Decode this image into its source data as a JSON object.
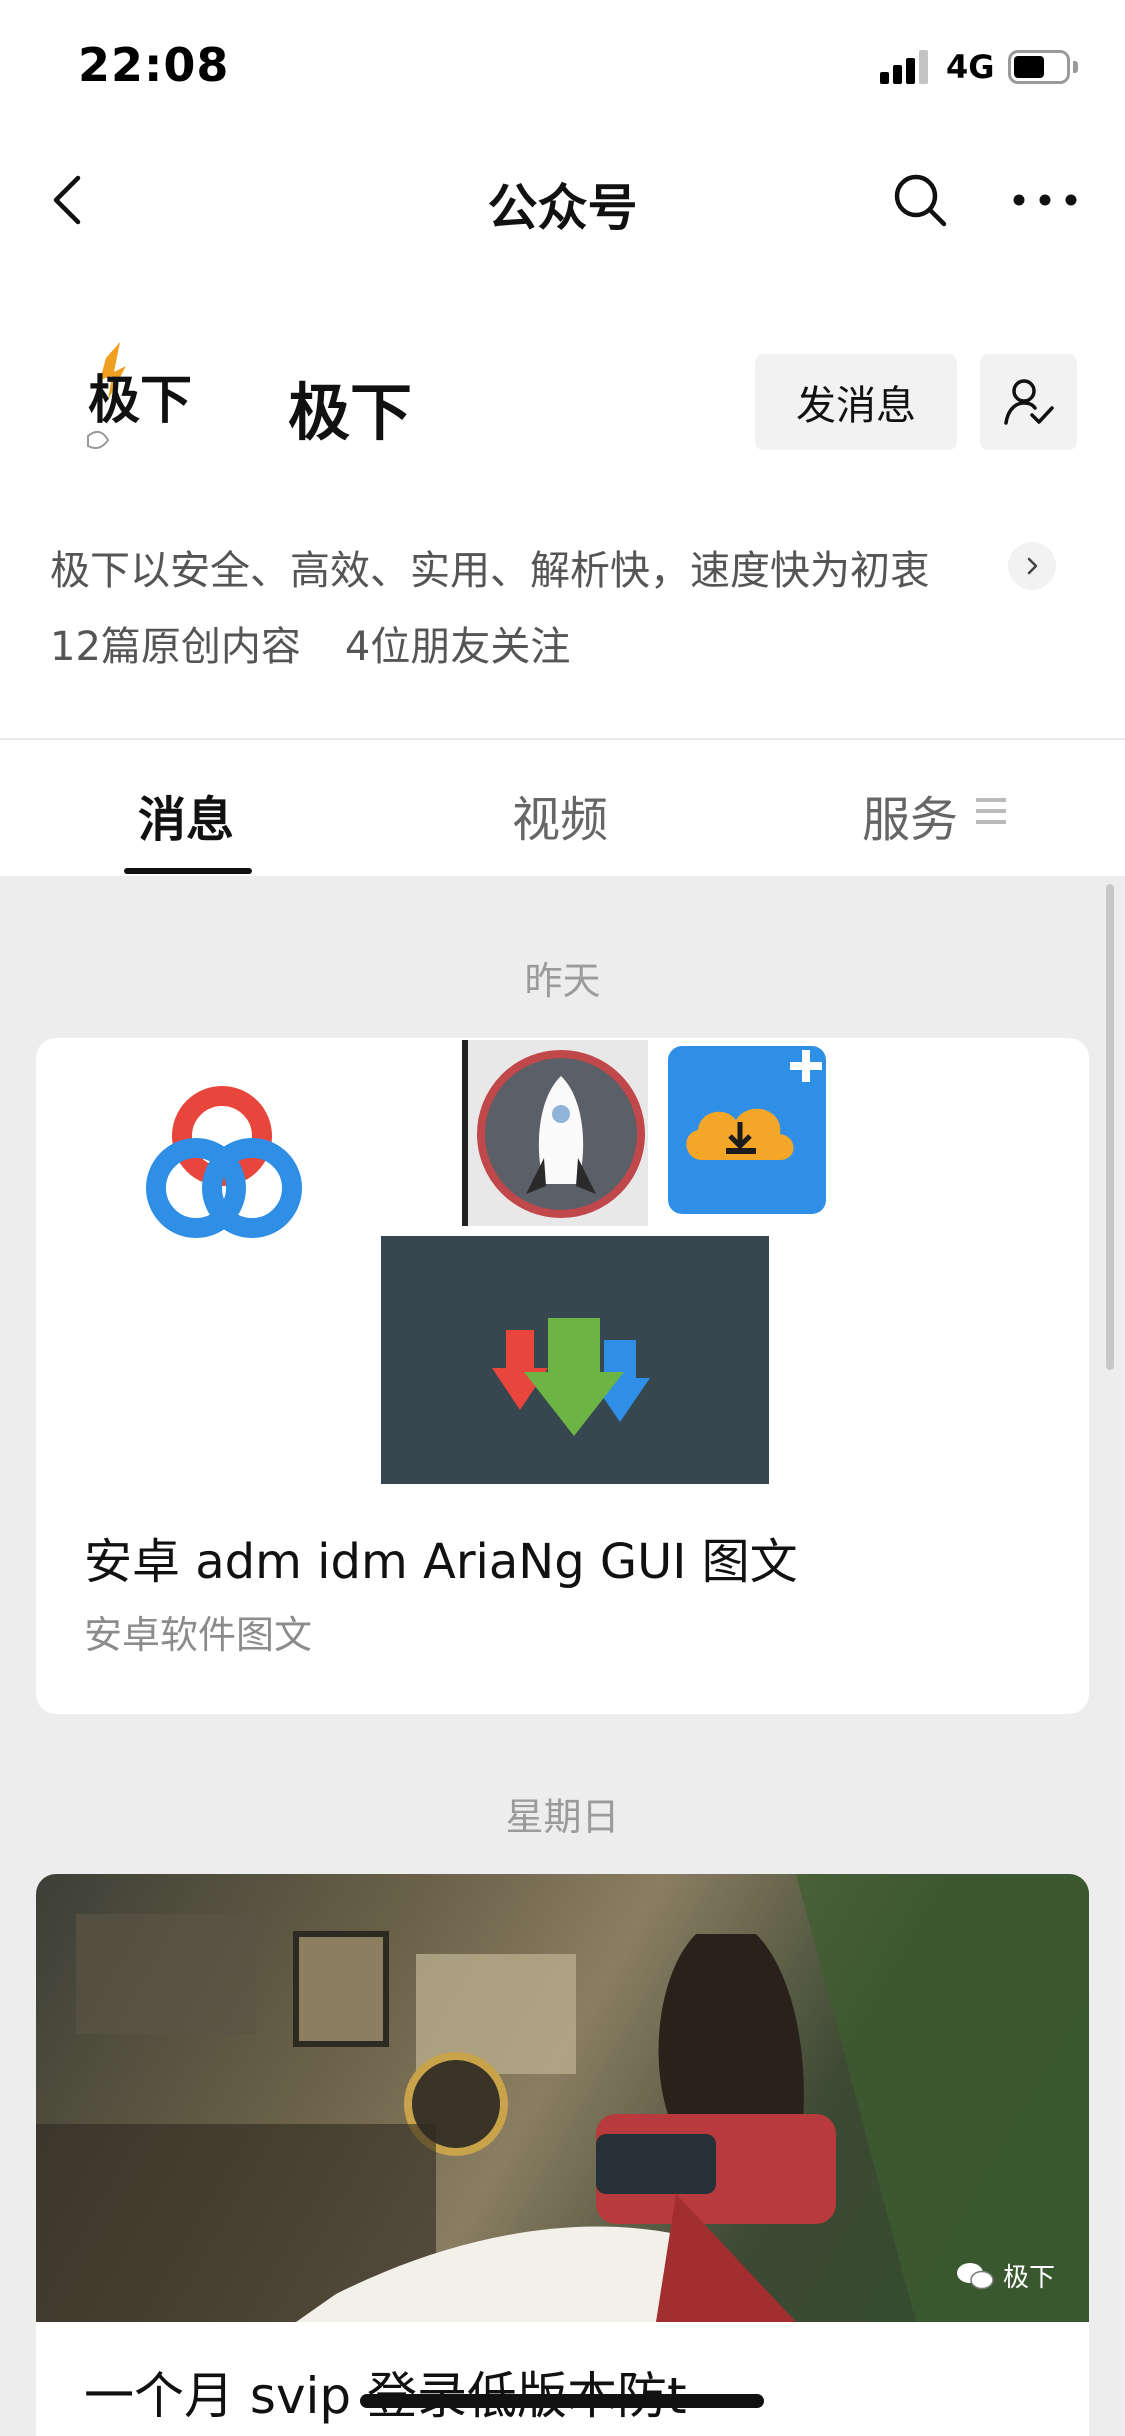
{
  "status_bar": {
    "time": "22:08",
    "network": "4G",
    "battery_level": 0.6,
    "signal_bars": 3
  },
  "nav": {
    "title": "公众号",
    "back_icon": "chevron-left-icon",
    "search_icon": "search-icon",
    "more_icon": "more-horizontal-icon"
  },
  "profile": {
    "name": "极下",
    "logo_text": "极下",
    "send_message_label": "发消息",
    "follow_icon": "user-check-icon",
    "description": "极下以安全、高效、实用、解析快，速度快为初衷",
    "original_count_label": "12篇原创内容",
    "friends_follow_label": "4位朋友关注"
  },
  "tabs": [
    {
      "label": "消息",
      "active": true
    },
    {
      "label": "视频",
      "active": false
    },
    {
      "label": "服务",
      "active": false
    }
  ],
  "messages": [
    {
      "date": "昨天",
      "title": "安卓 adm idm AriaNg GUI 图文",
      "subtitle": "安卓软件图文",
      "icons": [
        "baidu-netdisk-icon",
        "rocket-app-icon",
        "cloud-download-plus-icon",
        "adm-download-arrows-icon"
      ]
    },
    {
      "date": "星期日",
      "title": "一个月 svip 登录低版本防t",
      "watermark": "极下"
    }
  ],
  "colors": {
    "accent_red": "#e8453c",
    "accent_blue": "#2f8fe6",
    "accent_green": "#6cb443",
    "background": "#ededed"
  }
}
